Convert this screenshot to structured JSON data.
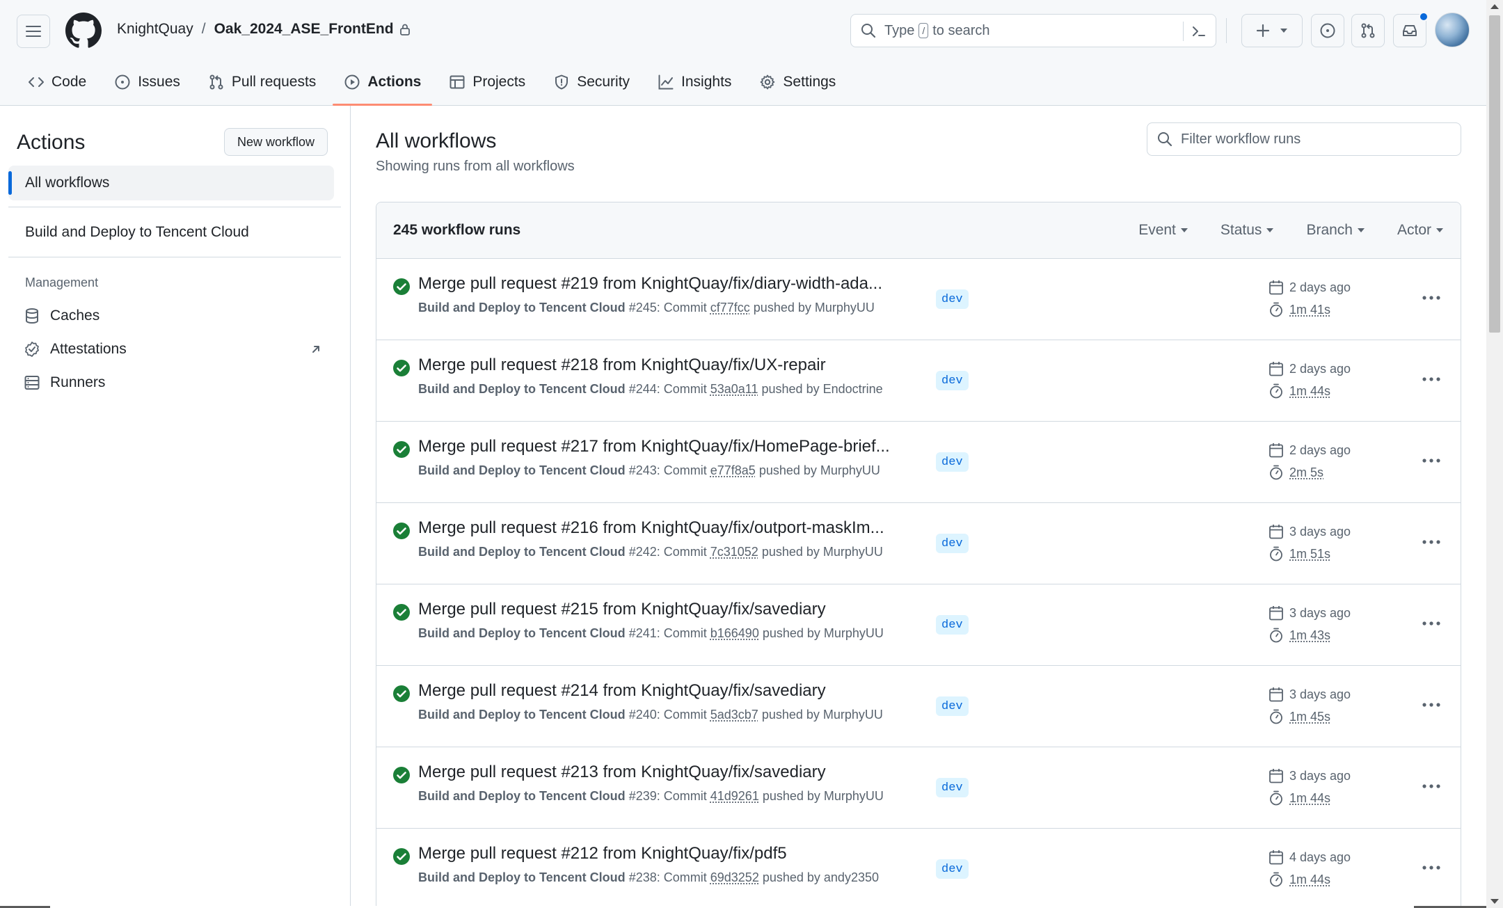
{
  "header": {
    "owner": "KnightQuay",
    "separator": "/",
    "repo": "Oak_2024_ASE_FrontEnd",
    "search": {
      "prefix": "Type",
      "key": "/",
      "suffix": "to search"
    }
  },
  "tabs": [
    {
      "label": "Code",
      "icon": "code-icon"
    },
    {
      "label": "Issues",
      "icon": "issue-opened-icon"
    },
    {
      "label": "Pull requests",
      "icon": "git-pull-request-icon"
    },
    {
      "label": "Actions",
      "icon": "play-icon",
      "active": true
    },
    {
      "label": "Projects",
      "icon": "table-icon"
    },
    {
      "label": "Security",
      "icon": "shield-icon"
    },
    {
      "label": "Insights",
      "icon": "graph-icon"
    },
    {
      "label": "Settings",
      "icon": "gear-icon"
    }
  ],
  "sidebar": {
    "title": "Actions",
    "new_workflow": "New workflow",
    "all_workflows": "All workflows",
    "workflow": "Build and Deploy to Tencent Cloud",
    "management_heading": "Management",
    "management": [
      {
        "label": "Caches",
        "icon": "database-icon"
      },
      {
        "label": "Attestations",
        "icon": "verified-icon"
      },
      {
        "label": "Runners",
        "icon": "server-icon"
      }
    ]
  },
  "main": {
    "title": "All workflows",
    "subtitle": "Showing runs from all workflows",
    "filter_placeholder": "Filter workflow runs",
    "runs_count": "245 workflow runs",
    "filters": [
      "Event",
      "Status",
      "Branch",
      "Actor"
    ]
  },
  "runs": [
    {
      "title": "Merge pull request #219 from KnightQuay/fix/diary-width-ada...",
      "workflow": "Build and Deploy to Tencent Cloud",
      "number": "#245: Commit",
      "sha": "cf77fcc",
      "pusher": "pushed by MurphyUU",
      "branch": "dev",
      "date": "2 days ago",
      "duration": "1m 41s"
    },
    {
      "title": "Merge pull request #218 from KnightQuay/fix/UX-repair",
      "workflow": "Build and Deploy to Tencent Cloud",
      "number": "#244: Commit",
      "sha": "53a0a11",
      "pusher": "pushed by Endoctrine",
      "branch": "dev",
      "date": "2 days ago",
      "duration": "1m 44s"
    },
    {
      "title": "Merge pull request #217 from KnightQuay/fix/HomePage-brief...",
      "workflow": "Build and Deploy to Tencent Cloud",
      "number": "#243: Commit",
      "sha": "e77f8a5",
      "pusher": "pushed by MurphyUU",
      "branch": "dev",
      "date": "2 days ago",
      "duration": "2m 5s"
    },
    {
      "title": "Merge pull request #216 from KnightQuay/fix/outport-maskIm...",
      "workflow": "Build and Deploy to Tencent Cloud",
      "number": "#242: Commit",
      "sha": "7c31052",
      "pusher": "pushed by MurphyUU",
      "branch": "dev",
      "date": "3 days ago",
      "duration": "1m 51s"
    },
    {
      "title": "Merge pull request #215 from KnightQuay/fix/savediary",
      "workflow": "Build and Deploy to Tencent Cloud",
      "number": "#241: Commit",
      "sha": "b166490",
      "pusher": "pushed by MurphyUU",
      "branch": "dev",
      "date": "3 days ago",
      "duration": "1m 43s"
    },
    {
      "title": "Merge pull request #214 from KnightQuay/fix/savediary",
      "workflow": "Build and Deploy to Tencent Cloud",
      "number": "#240: Commit",
      "sha": "5ad3cb7",
      "pusher": "pushed by MurphyUU",
      "branch": "dev",
      "date": "3 days ago",
      "duration": "1m 45s"
    },
    {
      "title": "Merge pull request #213 from KnightQuay/fix/savediary",
      "workflow": "Build and Deploy to Tencent Cloud",
      "number": "#239: Commit",
      "sha": "41d9261",
      "pusher": "pushed by MurphyUU",
      "branch": "dev",
      "date": "3 days ago",
      "duration": "1m 44s"
    },
    {
      "title": "Merge pull request #212 from KnightQuay/fix/pdf5",
      "workflow": "Build and Deploy to Tencent Cloud",
      "number": "#238: Commit",
      "sha": "69d3252",
      "pusher": "pushed by andy2350",
      "branch": "dev",
      "date": "4 days ago",
      "duration": "1m 44s"
    }
  ],
  "colors": {
    "accent": "#0969da",
    "success": "#1a7f37",
    "active_tab_underline": "#fd8c73",
    "branch_bg": "#ddf4ff"
  }
}
